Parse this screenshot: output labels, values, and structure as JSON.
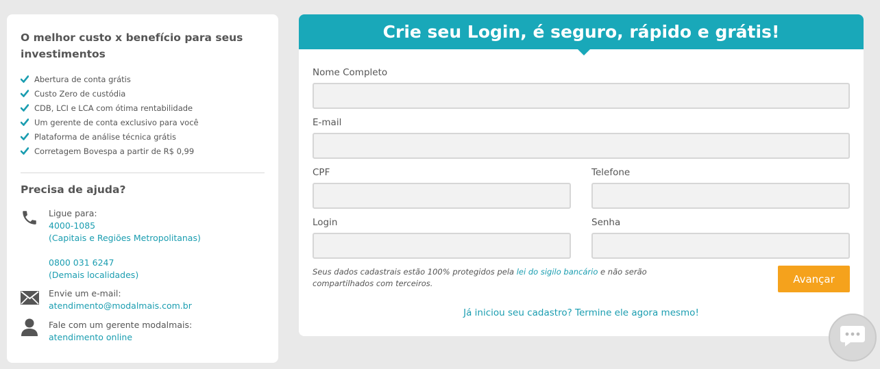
{
  "left": {
    "title": "O melhor custo x benefício para seus investimentos",
    "benefits": [
      "Abertura de conta grátis",
      "Custo Zero de custódia",
      "CDB, LCI e LCA com ótima rentabilidade",
      "Um gerente de conta exclusivo para você",
      "Plataforma de análise técnica grátis",
      "Corretagem Bovespa a partir de R$ 0,99"
    ],
    "help_title": "Precisa de ajuda?",
    "phone": {
      "label": "Ligue para:",
      "number1": "4000-1085",
      "region1": "(Capitais e Regiões Metropolitanas)",
      "number2": "0800 031 6247",
      "region2": "(Demais localidades)"
    },
    "email": {
      "label": "Envie um e-mail:",
      "address": "atendimento@modalmais.com.br"
    },
    "manager": {
      "label": "Fale com um gerente modalmais:",
      "link": "atendimento online"
    }
  },
  "form": {
    "title": "Crie seu Login, é seguro, rápido e grátis!",
    "fields": {
      "name_label": "Nome Completo",
      "email_label": "E-mail",
      "cpf_label": "CPF",
      "phone_label": "Telefone",
      "login_label": "Login",
      "password_label": "Senha"
    },
    "disclaimer_prefix": "Seus dados cadastrais estão 100% protegidos pela ",
    "disclaimer_link": "lei do sigilo bancário",
    "disclaimer_suffix": " e não serão compartilhados com terceiros.",
    "submit_label": "Avançar",
    "resume_link": "Já iniciou seu cadastro? Termine ele agora mesmo!"
  },
  "colors": {
    "accent": "#19a8b9",
    "link": "#1a9db0",
    "button": "#f5a21c"
  },
  "icons": [
    "check-icon",
    "phone-icon",
    "envelope-icon",
    "person-icon",
    "chat-icon"
  ]
}
